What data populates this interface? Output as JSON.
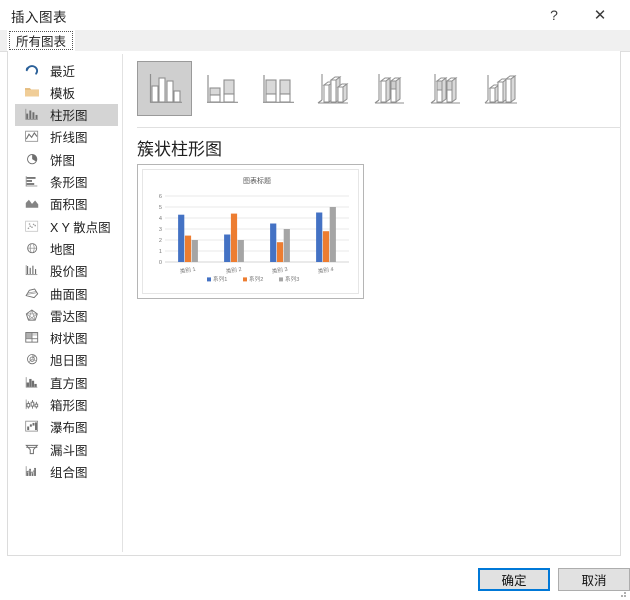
{
  "window": {
    "title": "插入图表",
    "help_label": "?",
    "close_label": "✕"
  },
  "tabs": [
    {
      "label": "所有图表",
      "active": true
    }
  ],
  "sidebar": {
    "items": [
      {
        "label": "最近",
        "icon": "recent-undo-icon",
        "selected": false
      },
      {
        "label": "模板",
        "icon": "template-folder-icon",
        "selected": false
      },
      {
        "label": "柱形图",
        "icon": "column-chart-icon",
        "selected": true
      },
      {
        "label": "折线图",
        "icon": "line-chart-icon",
        "selected": false
      },
      {
        "label": "饼图",
        "icon": "pie-chart-icon",
        "selected": false
      },
      {
        "label": "条形图",
        "icon": "bar-chart-icon",
        "selected": false
      },
      {
        "label": "面积图",
        "icon": "area-chart-icon",
        "selected": false
      },
      {
        "label": "X Y 散点图",
        "icon": "scatter-chart-icon",
        "selected": false
      },
      {
        "label": "地图",
        "icon": "map-chart-icon",
        "selected": false
      },
      {
        "label": "股价图",
        "icon": "stock-chart-icon",
        "selected": false
      },
      {
        "label": "曲面图",
        "icon": "surface-chart-icon",
        "selected": false
      },
      {
        "label": "雷达图",
        "icon": "radar-chart-icon",
        "selected": false
      },
      {
        "label": "树状图",
        "icon": "treemap-chart-icon",
        "selected": false
      },
      {
        "label": "旭日图",
        "icon": "sunburst-chart-icon",
        "selected": false
      },
      {
        "label": "直方图",
        "icon": "histogram-chart-icon",
        "selected": false
      },
      {
        "label": "箱形图",
        "icon": "boxplot-chart-icon",
        "selected": false
      },
      {
        "label": "瀑布图",
        "icon": "waterfall-chart-icon",
        "selected": false
      },
      {
        "label": "漏斗图",
        "icon": "funnel-chart-icon",
        "selected": false
      },
      {
        "label": "组合图",
        "icon": "combo-chart-icon",
        "selected": false
      }
    ]
  },
  "gallery": {
    "thumbnails": [
      {
        "name": "clustered-column",
        "selected": true
      },
      {
        "name": "stacked-column",
        "selected": false
      },
      {
        "name": "100-percent-stacked-column",
        "selected": false
      },
      {
        "name": "3d-clustered-column",
        "selected": false
      },
      {
        "name": "3d-stacked-column",
        "selected": false
      },
      {
        "name": "3d-100-percent-stacked-column",
        "selected": false
      },
      {
        "name": "3d-column",
        "selected": false
      }
    ]
  },
  "preview": {
    "heading": "簇状柱形图"
  },
  "chart_data": {
    "type": "bar",
    "title": "图表标题",
    "xlabel": "",
    "ylabel": "",
    "categories": [
      "类别 1",
      "类别 2",
      "类别 3",
      "类别 4"
    ],
    "series": [
      {
        "name": "系列1",
        "color": "#4472C4",
        "values": [
          4.3,
          2.5,
          3.5,
          4.5
        ]
      },
      {
        "name": "系列2",
        "color": "#ED7D31",
        "values": [
          2.4,
          4.4,
          1.8,
          2.8
        ]
      },
      {
        "name": "系列3",
        "color": "#A5A5A5",
        "values": [
          2.0,
          2.0,
          3.0,
          5.0
        ]
      }
    ],
    "yticks": [
      0,
      1,
      2,
      3,
      4,
      5,
      6
    ],
    "ylim": [
      0,
      6
    ],
    "grid": true,
    "legend_position": "bottom"
  },
  "footer": {
    "ok_label": "确定",
    "cancel_label": "取消"
  }
}
